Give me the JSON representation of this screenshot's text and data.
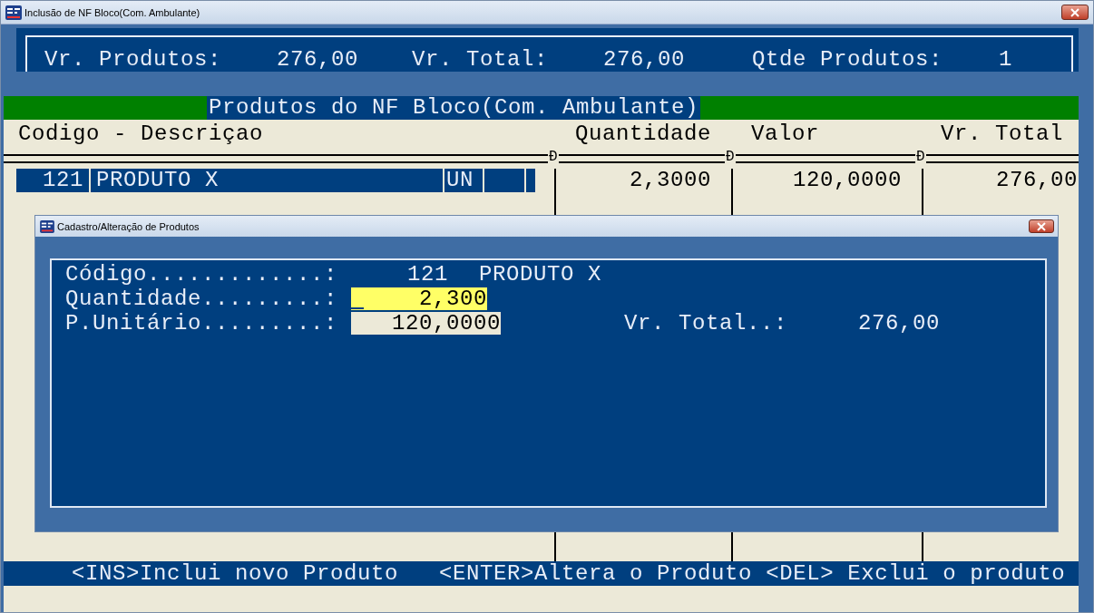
{
  "window": {
    "title": "Inclusão  de NF Bloco(Com. Ambulante)"
  },
  "totals": [
    {
      "label": "Vr. Produtos:",
      "value": "276,00"
    },
    {
      "label": "Vr. Total:",
      "value": "276,00"
    },
    {
      "label": "Qtde Produtos:",
      "value": "1"
    }
  ],
  "section_title": "Produtos do NF Bloco(Com. Ambulante)",
  "table": {
    "columns": [
      "Codigo - Descriçao",
      "Quantidade",
      "Valor",
      "Vr. Total"
    ],
    "rule_marks": [
      "Ð",
      "Ð",
      "Ð"
    ],
    "rows": [
      {
        "code": "121",
        "description": "PRODUTO X",
        "unit": "UN",
        "quantity": "2,3000",
        "price": "120,0000",
        "total": "276,00",
        "selected": true
      }
    ]
  },
  "dialog": {
    "title": "Cadastro/Alteração de Produtos",
    "fields": [
      {
        "kind": "text",
        "label": "Código.............:",
        "code": "121",
        "name": "PRODUTO X"
      },
      {
        "kind": "input",
        "label": "Quantidade.........:",
        "value": "2,300",
        "focused": true
      },
      {
        "kind": "input",
        "label": "P.Unitário.........:",
        "value": "120,0000",
        "focused": false,
        "extra_label": "Vr. Total..:",
        "extra_value": "276,00"
      }
    ]
  },
  "status_bar": [
    "<INS>Inclui novo Produto",
    "<ENTER>Altera o Produto",
    "<DEL> Exclui o produto"
  ]
}
